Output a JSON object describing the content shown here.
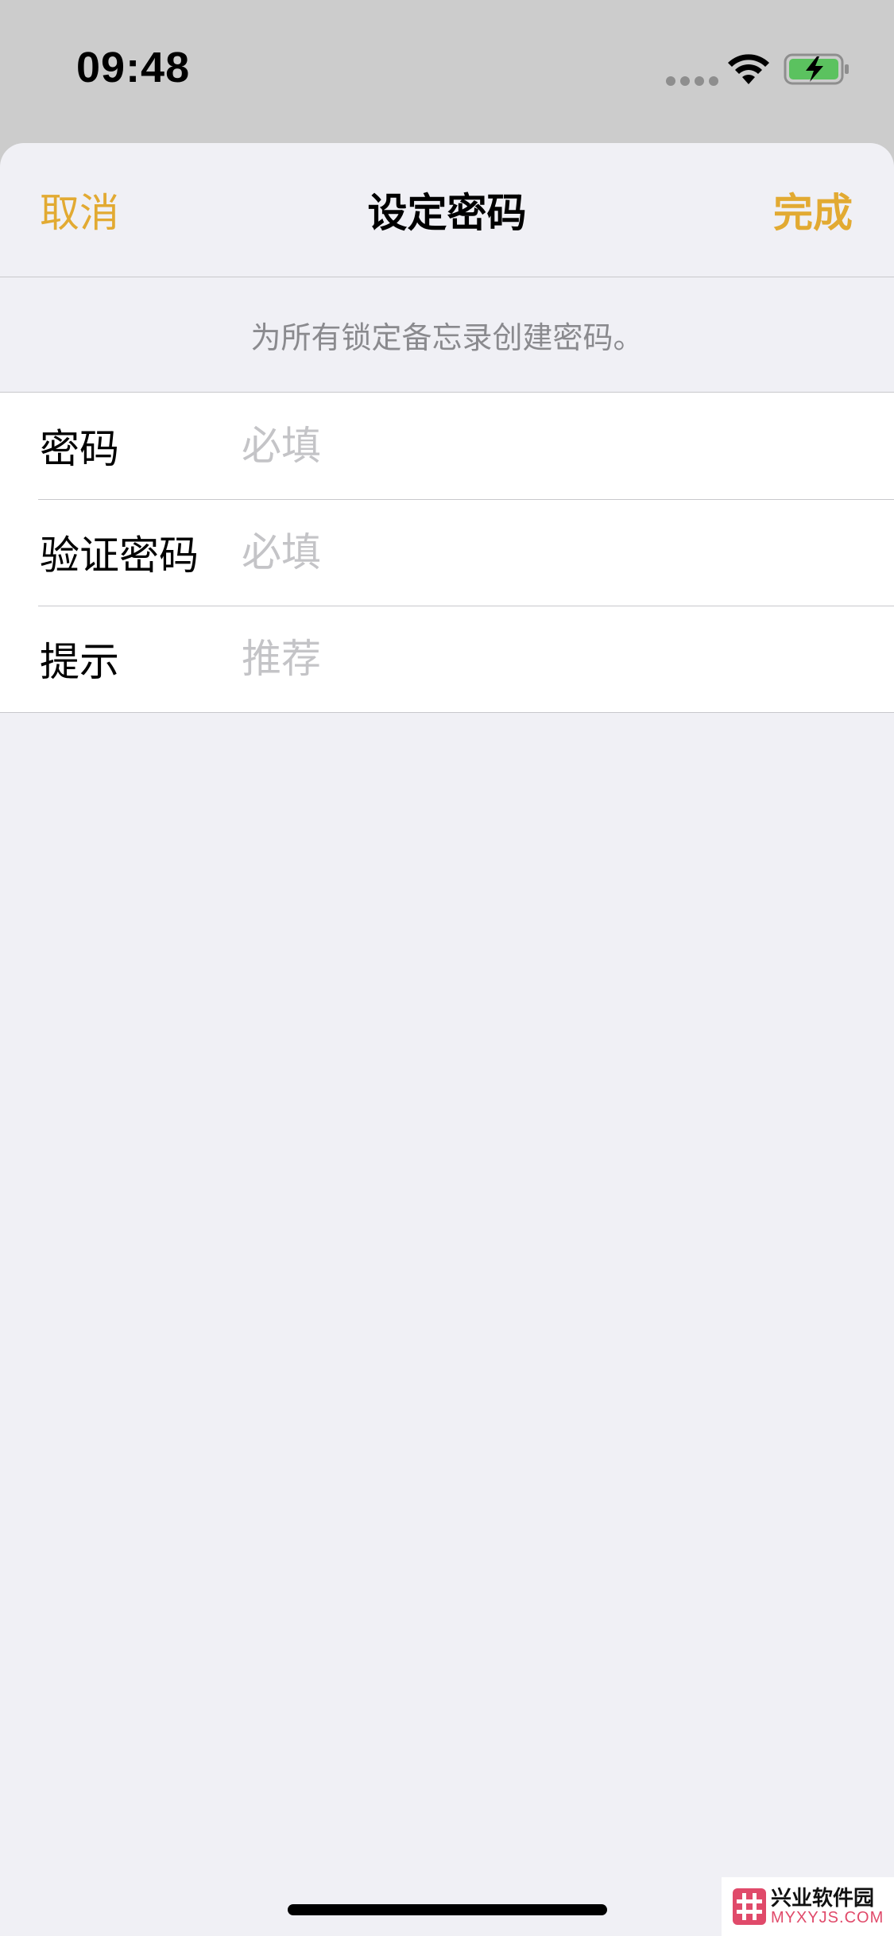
{
  "status_bar": {
    "time": "09:48",
    "icons": [
      "cellular-signal-icon",
      "wifi-icon",
      "battery-charging-icon"
    ]
  },
  "nav": {
    "cancel_label": "取消",
    "title": "设定密码",
    "done_label": "完成"
  },
  "note": "为所有锁定备忘录创建密码。",
  "form": {
    "rows": [
      {
        "label": "密码",
        "value": "",
        "placeholder": "必填"
      },
      {
        "label": "验证密码",
        "value": "",
        "placeholder": "必填"
      },
      {
        "label": "提示",
        "value": "",
        "placeholder": "推荐"
      }
    ]
  },
  "watermark": {
    "title": "兴业软件园",
    "subtitle": "MYXYJS.COM"
  },
  "colors": {
    "accent": "#e2aa32",
    "background": "#f0f0f5",
    "status_bar_bg": "#cccccc",
    "battery_green": "#5bc25f",
    "placeholder": "#c4c4c7",
    "note_text": "#8a8a8e"
  }
}
